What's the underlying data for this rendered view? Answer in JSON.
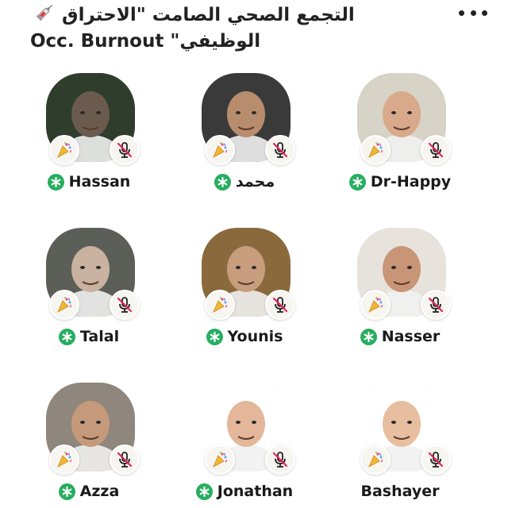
{
  "room": {
    "title_line1": "التجمع الصحي الصامت \"الاحتراق",
    "title_line2": "Occ. Burnout \"الوظيفي",
    "title_icon": "syringe-icon"
  },
  "header": {
    "more_icon": "more-dots-icon"
  },
  "colors": {
    "moderator": "#27ae60",
    "badge_bg": "#f7f5f0",
    "mute_slash": "#e0245e",
    "text": "#1a1a1a"
  },
  "speakers": [
    {
      "name": "Hassan",
      "moderator": true,
      "tone": "#6b5a4e",
      "bg": "#2f3d2c"
    },
    {
      "name": "محمد",
      "moderator": true,
      "tone": "#b88d6e",
      "bg": "#3a3a3a"
    },
    {
      "name": "Dr-Happy",
      "moderator": true,
      "tone": "#d8a98a",
      "bg": "#d7d3c6"
    },
    {
      "name": "Talal",
      "moderator": true,
      "tone": "#c9b2a0",
      "bg": "#5b5f58"
    },
    {
      "name": "Younis",
      "moderator": true,
      "tone": "#c89d7d",
      "bg": "#8a6a3c"
    },
    {
      "name": "Nasser",
      "moderator": true,
      "tone": "#c89576",
      "bg": "#e7e3dc"
    },
    {
      "name": "Azza",
      "moderator": true,
      "tone": "#c59a7a",
      "bg": "#8f867d"
    },
    {
      "name": "Jonathan",
      "moderator": true,
      "tone": "#e4b79a",
      "bg": "#ffffff"
    },
    {
      "name": "Bashayer",
      "moderator": false,
      "tone": "#e8bea0",
      "bg": "#ffffff"
    }
  ]
}
